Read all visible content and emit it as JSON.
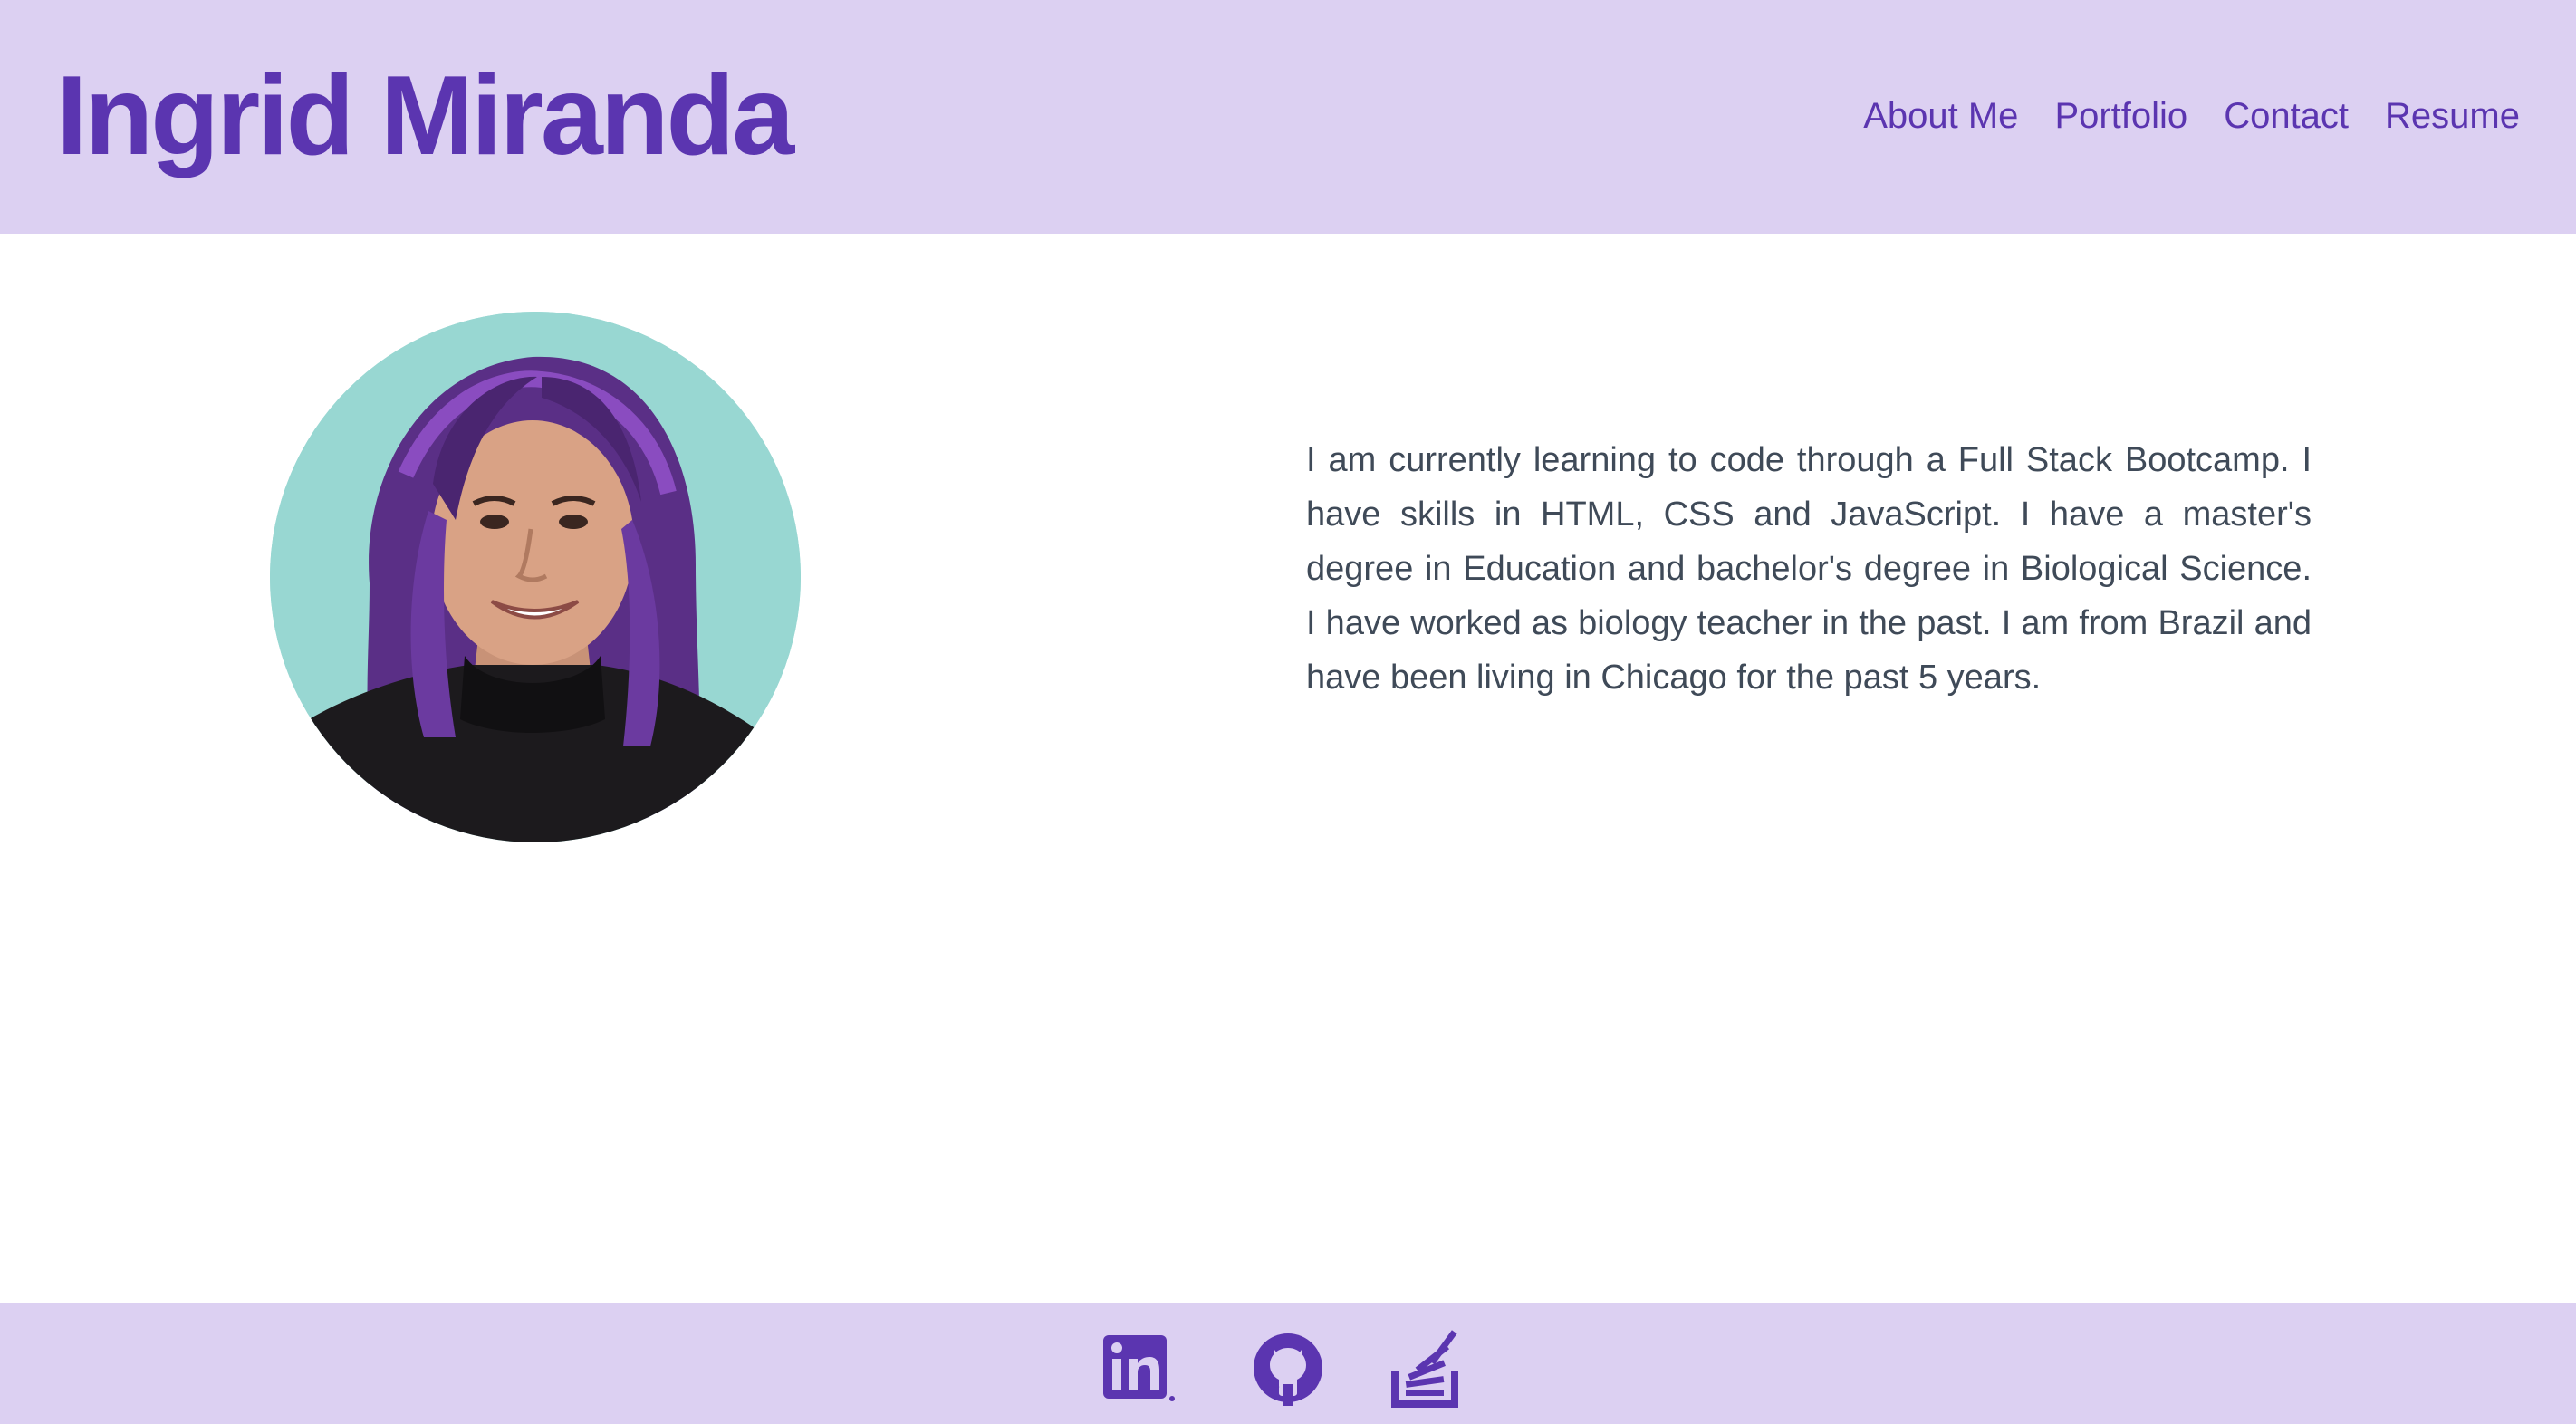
{
  "header": {
    "title": "Ingrid Miranda",
    "nav": [
      {
        "label": "About Me"
      },
      {
        "label": "Portfolio"
      },
      {
        "label": "Contact"
      },
      {
        "label": "Resume"
      }
    ]
  },
  "main": {
    "avatar_icon": "profile-photo",
    "bio": "I am currently learning to code through a Full Stack Bootcamp. I have skills in HTML, CSS and JavaScript. I have a master's degree in Education and bachelor's degree in Biological Science. I have worked as biology teacher in the past. I am from Brazil and have been living in Chicago for the past 5 years."
  },
  "footer": {
    "social": [
      {
        "icon": "linkedin-icon"
      },
      {
        "icon": "github-icon"
      },
      {
        "icon": "stack-overflow-icon"
      }
    ]
  },
  "colors": {
    "accent": "#5b35b0",
    "header_bg": "#dcd0f2",
    "avatar_bg": "#98d7d2",
    "body_text": "#3f4a58"
  }
}
